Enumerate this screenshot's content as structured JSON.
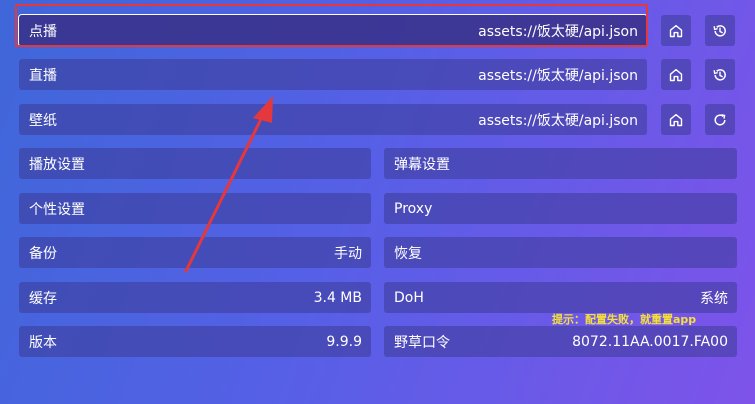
{
  "source_rows": [
    {
      "label": "点播",
      "value": "assets://饭太硬/api.json",
      "icons": [
        "home-icon",
        "history-icon"
      ]
    },
    {
      "label": "直播",
      "value": "assets://饭太硬/api.json",
      "icons": [
        "home-icon",
        "history-icon"
      ]
    },
    {
      "label": "壁纸",
      "value": "assets://饭太硬/api.json",
      "icons": [
        "home-icon",
        "refresh-icon"
      ]
    }
  ],
  "settings": {
    "playback": {
      "label": "播放设置"
    },
    "danmaku": {
      "label": "弹幕设置"
    },
    "personal": {
      "label": "个性设置"
    },
    "proxy": {
      "label": "Proxy"
    },
    "backup": {
      "label": "备份",
      "value": "手动"
    },
    "restore": {
      "label": "恢复"
    },
    "cache": {
      "label": "缓存",
      "value": "3.4 MB"
    },
    "doh": {
      "label": "DoH",
      "value": "系统"
    },
    "version": {
      "label": "版本",
      "value": "9.9.9"
    },
    "password": {
      "label": "野草口令",
      "value": "8072.11AA.0017.FA00"
    }
  },
  "annotation": {
    "hint": "提示：配置失败，就重置app"
  },
  "colors": {
    "highlight": "#e5383d",
    "hint_text": "#f3e03c",
    "cell_bg": "#3c3a96"
  }
}
